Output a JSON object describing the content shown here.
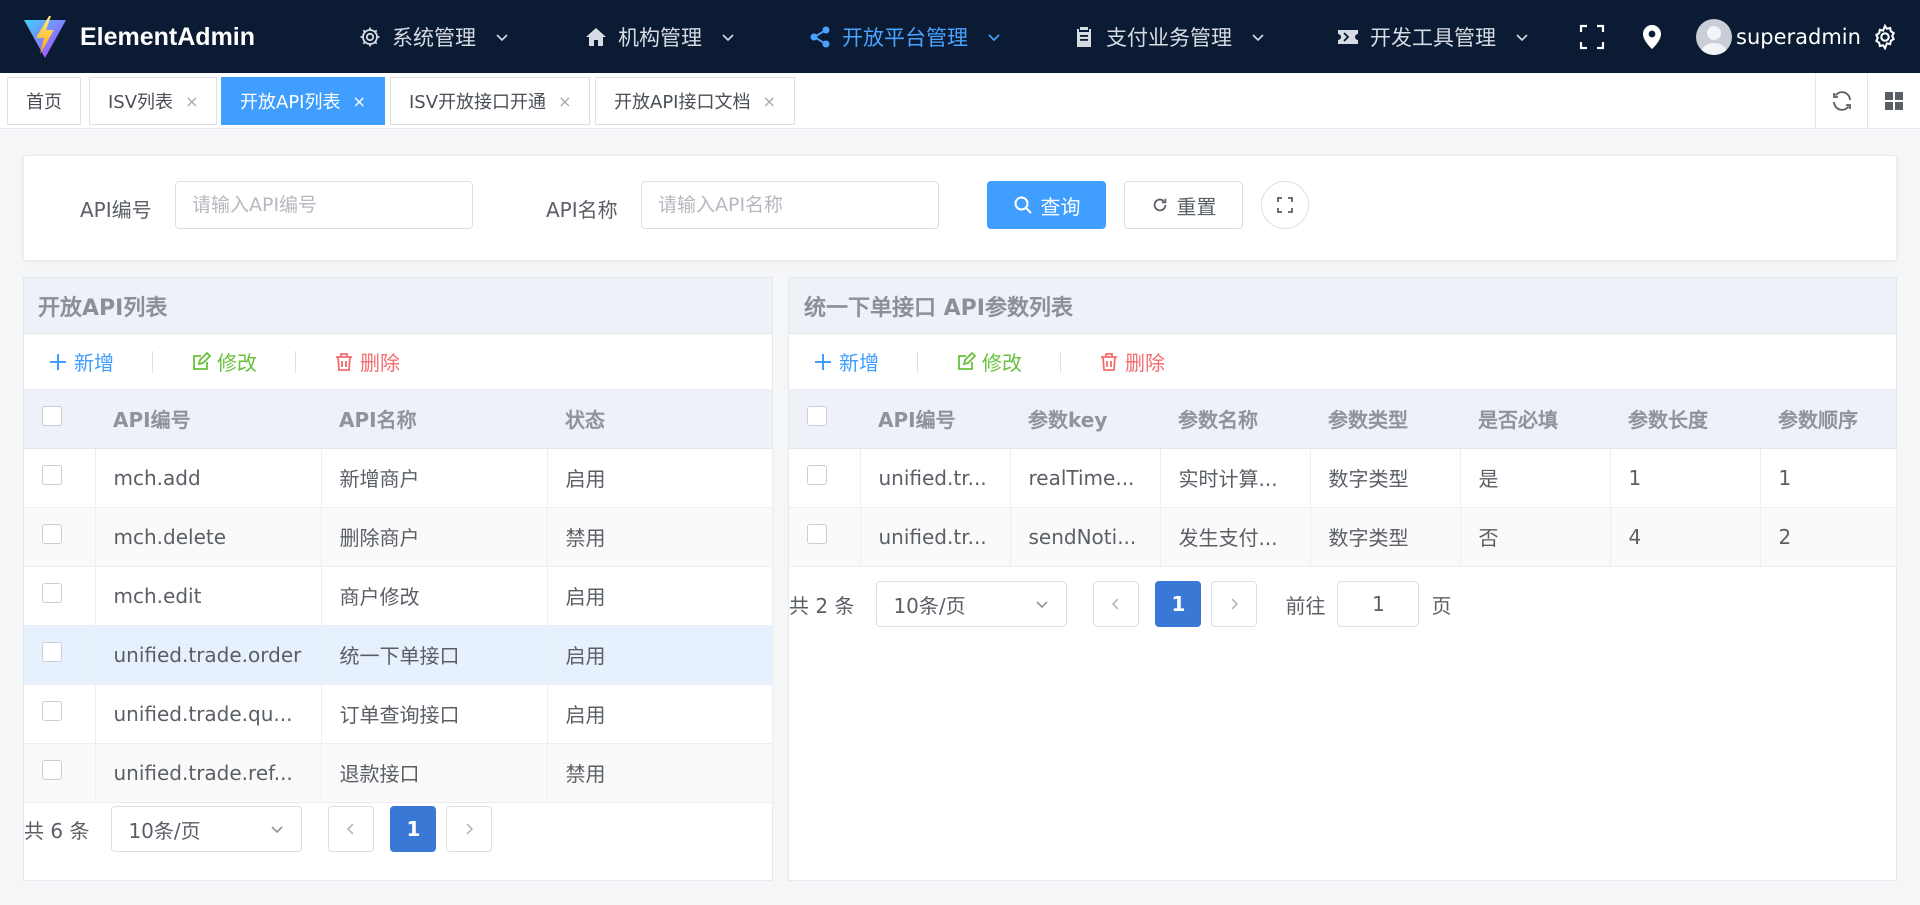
{
  "brand": {
    "name": "ElementAdmin"
  },
  "nav": {
    "items": [
      {
        "label": "系统管理",
        "icon": "gear-icon"
      },
      {
        "label": "机构管理",
        "icon": "home-icon"
      },
      {
        "label": "开放平台管理",
        "icon": "share-icon"
      },
      {
        "label": "支付业务管理",
        "icon": "clipboard-icon"
      },
      {
        "label": "开发工具管理",
        "icon": "ticket-icon"
      }
    ],
    "active_index": 2,
    "user": "superadmin"
  },
  "tags": {
    "items": [
      {
        "label": "首页",
        "closable": false
      },
      {
        "label": "ISV列表",
        "closable": true
      },
      {
        "label": "开放API列表",
        "closable": true
      },
      {
        "label": "ISV开放接口开通",
        "closable": true
      },
      {
        "label": "开放API接口文档",
        "closable": true
      }
    ],
    "active_index": 2,
    "close_glyph": "×"
  },
  "search": {
    "api_code_label": "API编号",
    "api_code_placeholder": "请输入API编号",
    "api_name_label": "API名称",
    "api_name_placeholder": "请输入API名称",
    "query_label": "查询",
    "reset_label": "重置"
  },
  "left_panel": {
    "title": "开放API列表",
    "toolbar": {
      "add": "新增",
      "edit": "修改",
      "delete": "删除"
    },
    "columns": [
      "API编号",
      "API名称",
      "状态"
    ],
    "rows": [
      [
        "mch.add",
        "新增商户",
        "启用"
      ],
      [
        "mch.delete",
        "删除商户",
        "禁用"
      ],
      [
        "mch.edit",
        "商户修改",
        "启用"
      ],
      [
        "unified.trade.order",
        "统一下单接口",
        "启用"
      ],
      [
        "unified.trade.qu...",
        "订单查询接口",
        "启用"
      ],
      [
        "unified.trade.ref...",
        "退款接口",
        "禁用"
      ]
    ],
    "selected_row": 3,
    "pager": {
      "total": "共 6 条",
      "size": "10条/页",
      "page": "1"
    }
  },
  "right_panel": {
    "title": "统一下单接口  API参数列表",
    "toolbar": {
      "add": "新增",
      "edit": "修改",
      "delete": "删除"
    },
    "columns": [
      "API编号",
      "参数key",
      "参数名称",
      "参数类型",
      "是否必填",
      "参数长度",
      "参数顺序"
    ],
    "rows": [
      [
        "unified.tr...",
        "realTime...",
        "实时计算...",
        "数字类型",
        "是",
        "1",
        "1"
      ],
      [
        "unified.tr...",
        "sendNoti...",
        "发生支付...",
        "数字类型",
        "否",
        "4",
        "2"
      ]
    ],
    "pager": {
      "total": "共 2 条",
      "size": "10条/页",
      "page": "1",
      "goto_label": "前往",
      "goto_value": "1",
      "page_unit": "页"
    }
  },
  "colors": {
    "navbar_bg": "#0b1b33",
    "primary": "#409eff",
    "success": "#67c23a",
    "danger": "#f56c6c",
    "page_btn": "#3a78d6"
  }
}
